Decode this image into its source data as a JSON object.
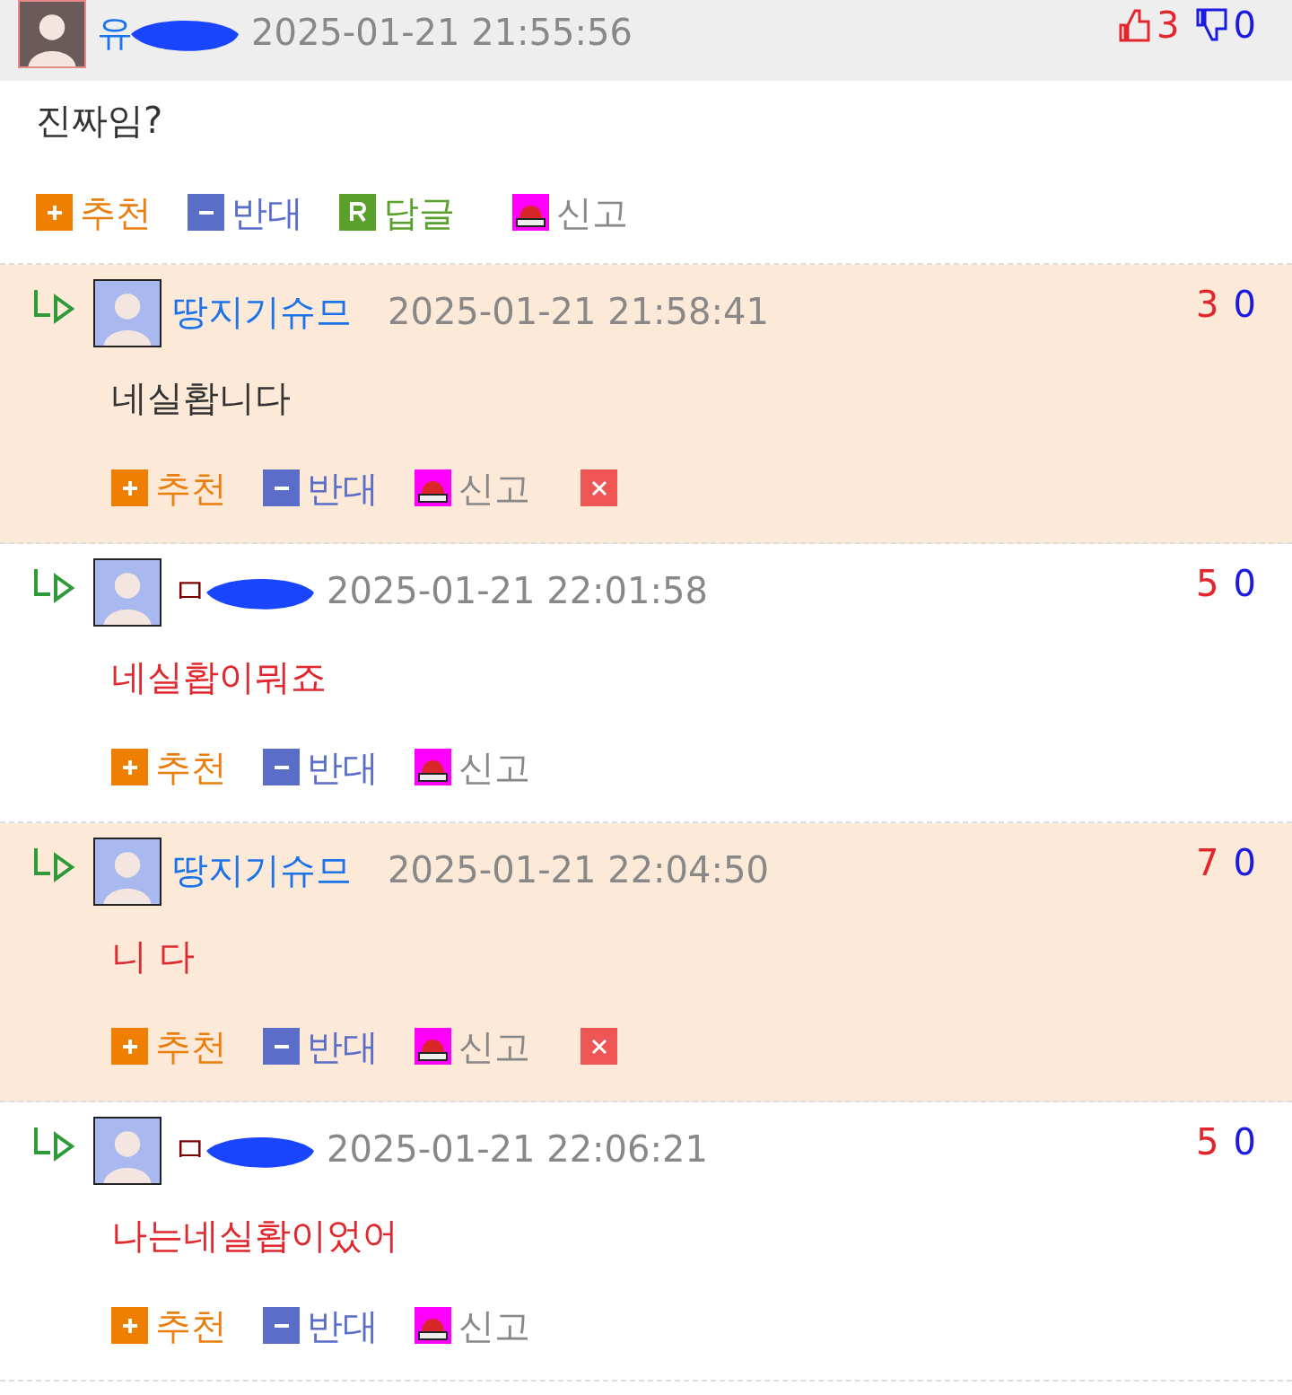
{
  "comments": [
    {
      "kind": "root",
      "highlighted": false,
      "name": "유",
      "special_name": false,
      "redacted": true,
      "time": "2025-01-21 21:55:56",
      "up": "3",
      "down": "0",
      "message": "진짜임?",
      "message_emphasis": false,
      "actions": [
        {
          "kind": "recommend",
          "label": "추천"
        },
        {
          "kind": "oppose",
          "label": "반대"
        },
        {
          "kind": "reply",
          "label": "답글"
        },
        {
          "kind": "report",
          "label": "신고"
        }
      ]
    },
    {
      "kind": "reply",
      "highlighted": true,
      "name": "땅지기슈므",
      "special_name": false,
      "redacted": false,
      "time": "2025-01-21 21:58:41",
      "up": "3",
      "down": "0",
      "message": "네실홥니다",
      "message_emphasis": false,
      "actions": [
        {
          "kind": "recommend",
          "label": "추천"
        },
        {
          "kind": "oppose",
          "label": "반대"
        },
        {
          "kind": "report",
          "label": "신고"
        },
        {
          "kind": "delete"
        }
      ]
    },
    {
      "kind": "reply",
      "highlighted": false,
      "name": "ㅁ",
      "special_name": true,
      "redacted": true,
      "time": "2025-01-21 22:01:58",
      "up": "5",
      "down": "0",
      "message": "네실홥이뭐죠",
      "message_emphasis": true,
      "actions": [
        {
          "kind": "recommend",
          "label": "추천"
        },
        {
          "kind": "oppose",
          "label": "반대"
        },
        {
          "kind": "report",
          "label": "신고"
        }
      ]
    },
    {
      "kind": "reply",
      "highlighted": true,
      "name": "땅지기슈므",
      "special_name": false,
      "redacted": false,
      "time": "2025-01-21 22:04:50",
      "up": "7",
      "down": "0",
      "message": "니 다",
      "message_emphasis": true,
      "actions": [
        {
          "kind": "recommend",
          "label": "추천"
        },
        {
          "kind": "oppose",
          "label": "반대"
        },
        {
          "kind": "report",
          "label": "신고"
        },
        {
          "kind": "delete"
        }
      ]
    },
    {
      "kind": "reply",
      "highlighted": false,
      "name": "ㅁ",
      "special_name": true,
      "redacted": true,
      "time": "2025-01-21 22:06:21",
      "up": "5",
      "down": "0",
      "message": "나는네실홥이었어",
      "message_emphasis": true,
      "actions": [
        {
          "kind": "recommend",
          "label": "추천"
        },
        {
          "kind": "oppose",
          "label": "반대"
        },
        {
          "kind": "report",
          "label": "신고"
        }
      ]
    }
  ]
}
